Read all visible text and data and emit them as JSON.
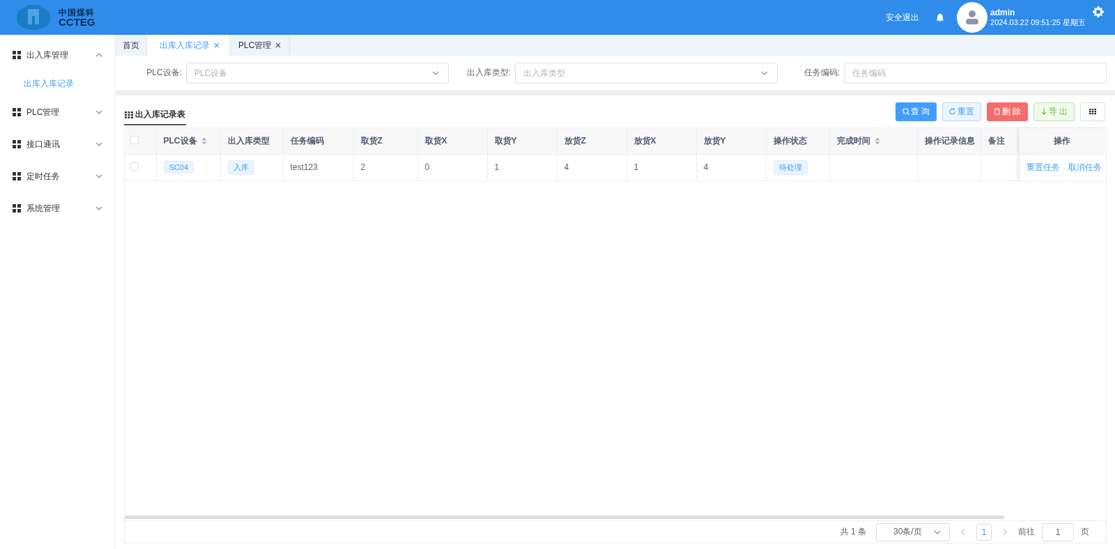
{
  "header": {
    "logo": {
      "line1": "中国煤科",
      "line2": "CCTEG"
    },
    "logout": "安全退出",
    "user": {
      "name": "admin",
      "datetime": "2024.03.22 09:51:25 星期五"
    }
  },
  "sidebar": {
    "items": [
      {
        "label": "出入库管理",
        "expanded": true,
        "children": [
          {
            "label": "出库入库记录",
            "selected": true
          }
        ]
      },
      {
        "label": "PLC管理",
        "expanded": false
      },
      {
        "label": "接口通讯",
        "expanded": false
      },
      {
        "label": "定时任务",
        "expanded": false
      },
      {
        "label": "系统管理",
        "expanded": false
      }
    ]
  },
  "tabs": [
    {
      "label": "首页",
      "selected": false,
      "closable": false
    },
    {
      "label": "出库入库记录",
      "selected": true,
      "closable": true
    },
    {
      "label": "PLC管理",
      "selected": false,
      "closable": true
    }
  ],
  "filters": [
    {
      "label": "PLC设备:",
      "placeholder": "PLC设备",
      "kind": "select"
    },
    {
      "label": "出入库类型:",
      "placeholder": "出入库类型",
      "kind": "select"
    },
    {
      "label": "任务编码:",
      "placeholder": "任务编码",
      "kind": "input"
    }
  ],
  "table_title": "出入库记录表",
  "toolbar": [
    {
      "label": "查 询",
      "kind": "primary"
    },
    {
      "label": "重置",
      "kind": "plain"
    },
    {
      "label": "删 除",
      "kind": "danger"
    },
    {
      "label": "导 出",
      "kind": "success"
    },
    {
      "kind": "columns"
    }
  ],
  "table": {
    "header_checked": false,
    "columns": [
      {
        "label": "PLC设备",
        "sortable": true
      },
      {
        "label": "出入库类型",
        "sortable": false
      },
      {
        "label": "任务编码",
        "sortable": false
      },
      {
        "label": "取货Z",
        "sortable": false
      },
      {
        "label": "取货X",
        "sortable": false
      },
      {
        "label": "取货Y",
        "sortable": false
      },
      {
        "label": "放货Z",
        "sortable": false
      },
      {
        "label": "放货X",
        "sortable": false
      },
      {
        "label": "放货Y",
        "sortable": false
      },
      {
        "label": "操作状态",
        "sortable": false
      },
      {
        "label": "完成时间",
        "sortable": true
      },
      {
        "label": "操作记录信息",
        "sortable": false
      },
      {
        "label": "备注",
        "sortable": false
      },
      {
        "label": "操作",
        "sortable": false
      }
    ],
    "rows": [
      {
        "checked": false,
        "cells": [
          {
            "text": "SC04",
            "kind": "tag"
          },
          {
            "text": "入库",
            "kind": "tag"
          },
          {
            "text": "test123"
          },
          {
            "text": "2"
          },
          {
            "text": "0"
          },
          {
            "text": "1"
          },
          {
            "text": "4"
          },
          {
            "text": "1"
          },
          {
            "text": "4"
          },
          {
            "text": "待处理",
            "kind": "tag"
          },
          {},
          {},
          {},
          {
            "kind": "actions",
            "links": [
              "重置任务",
              "取消任务"
            ]
          }
        ]
      }
    ]
  },
  "pagination": {
    "total": "共 1 条",
    "page_size": "30条/页",
    "pages": [
      {
        "label": "1",
        "selected": true
      }
    ],
    "goto_label": "前往",
    "goto_value": "1",
    "goto_suffix": "页"
  }
}
